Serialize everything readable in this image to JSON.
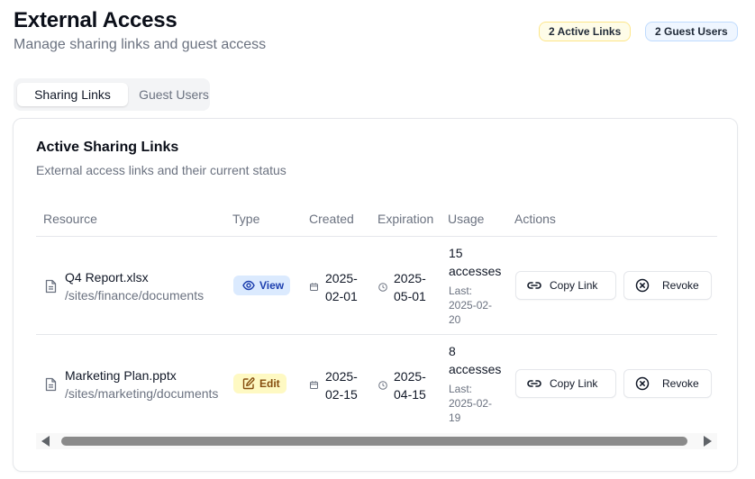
{
  "header": {
    "title": "External Access",
    "subtitle": "Manage sharing links and guest access"
  },
  "badges": {
    "active_links": "2 Active Links",
    "guest_users": "2 Guest Users"
  },
  "tabs": [
    {
      "label": "Sharing Links",
      "active": true
    },
    {
      "label": "Guest Users",
      "active": false
    }
  ],
  "card": {
    "title": "Active Sharing Links",
    "description": "External access links and their current status"
  },
  "table": {
    "columns": [
      "Resource",
      "Type",
      "Created",
      "Expiration",
      "Usage",
      "Actions"
    ],
    "rows": [
      {
        "name": "Q4 Report.xlsx",
        "path": "/sites/finance/documents",
        "type": "View",
        "created_l1": "2025-",
        "created_l2": "02-01",
        "expiration_l1": "2025-",
        "expiration_l2": "05-01",
        "usage_l1": "15",
        "usage_l2": "accesses",
        "last_l1": "Last:",
        "last_l2": "2025-02-",
        "last_l3": "20",
        "copy_label": "Copy Link",
        "revoke_label": "Revoke"
      },
      {
        "name": "Marketing Plan.pptx",
        "path": "/sites/marketing/documents",
        "type": "Edit",
        "created_l1": "2025-",
        "created_l2": "02-15",
        "expiration_l1": "2025-",
        "expiration_l2": "04-15",
        "usage_l1": "8",
        "usage_l2": "accesses",
        "last_l1": "Last:",
        "last_l2": "2025-02-",
        "last_l3": "19",
        "copy_label": "Copy Link",
        "revoke_label": "Revoke"
      }
    ]
  },
  "icons": {
    "document": "document-icon",
    "view": "eye-icon",
    "edit": "pencil-square-icon",
    "calendar": "calendar-icon",
    "clock": "clock-icon",
    "copy": "link-icon",
    "revoke": "x-circle-icon"
  },
  "colors": {
    "view_badge_bg": "#dbeafe",
    "view_badge_text": "#1e40af",
    "edit_badge_bg": "#fef9c3",
    "edit_badge_text": "#854d0e",
    "active_links_badge_bg": "#fefce8",
    "guest_users_badge_bg": "#eff6ff"
  }
}
